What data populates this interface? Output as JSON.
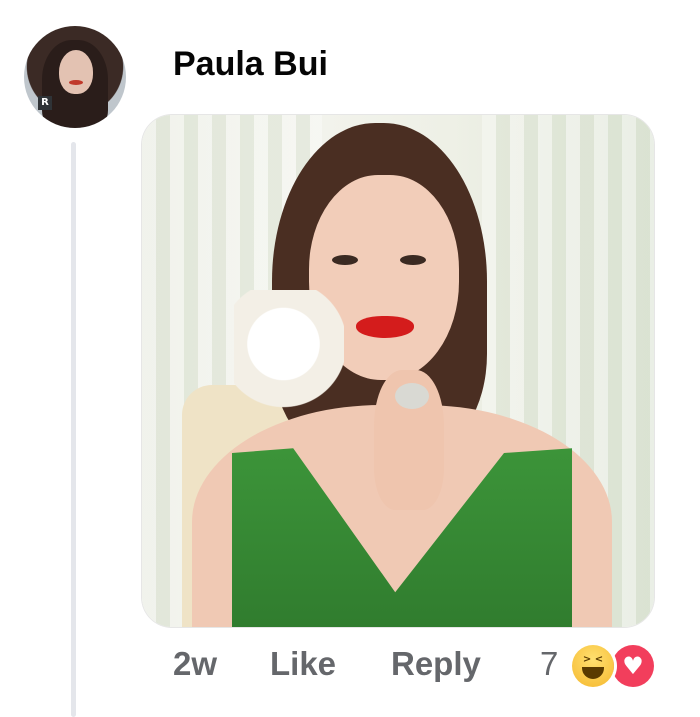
{
  "comment": {
    "author_name": "Paula Bui",
    "avatar_badge": "R",
    "timestamp": "2w",
    "like_label": "Like",
    "reply_label": "Reply",
    "reaction_count": "7",
    "reactions": [
      "haha-icon",
      "love-icon"
    ]
  },
  "icons": {
    "haha_eyes": "> <",
    "love_glyph": "♥"
  },
  "colors": {
    "text_primary": "#050505",
    "text_secondary": "#65676b",
    "thread_line": "#e4e6eb",
    "love": "#f23e5c",
    "haha": "#f5b82e"
  }
}
